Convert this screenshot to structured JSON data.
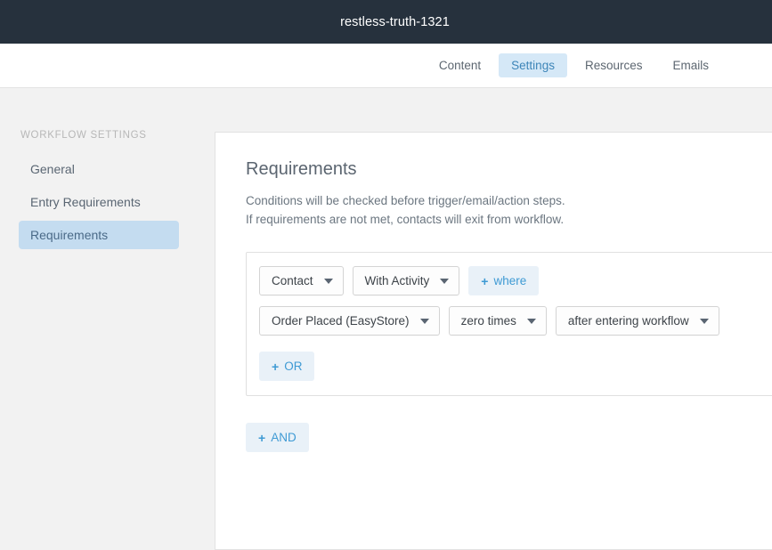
{
  "header": {
    "title": "restless-truth-1321"
  },
  "nav": {
    "tabs": [
      {
        "label": "Content",
        "active": false
      },
      {
        "label": "Settings",
        "active": true
      },
      {
        "label": "Resources",
        "active": false
      },
      {
        "label": "Emails",
        "active": false
      }
    ]
  },
  "sidebar": {
    "heading": "WORKFLOW SETTINGS",
    "items": [
      {
        "label": "General",
        "active": false
      },
      {
        "label": "Entry Requirements",
        "active": false
      },
      {
        "label": "Requirements",
        "active": true
      }
    ]
  },
  "main": {
    "title": "Requirements",
    "description_line1": "Conditions will be checked before trigger/email/action steps.",
    "description_line2": "If requirements are not met, contacts will exit from workflow.",
    "condition_group": {
      "row1": {
        "subject_dropdown": "Contact",
        "predicate_dropdown": "With Activity",
        "where_button": "where",
        "where_plus": "+"
      },
      "row2": {
        "activity_dropdown": "Order Placed (EasyStore)",
        "count_dropdown": "zero times",
        "timeframe_dropdown": "after entering workflow"
      },
      "or_button": "OR",
      "or_plus": "+"
    },
    "and_button": "AND",
    "and_plus": "+"
  },
  "colors": {
    "header_bg": "#26313d",
    "accent_blue": "#3e9ad4",
    "active_tab_bg": "#d5e8f7",
    "active_sidebar_bg": "#c4dcf0",
    "pill_bg": "#e9f1f8",
    "page_bg": "#f2f2f2"
  }
}
